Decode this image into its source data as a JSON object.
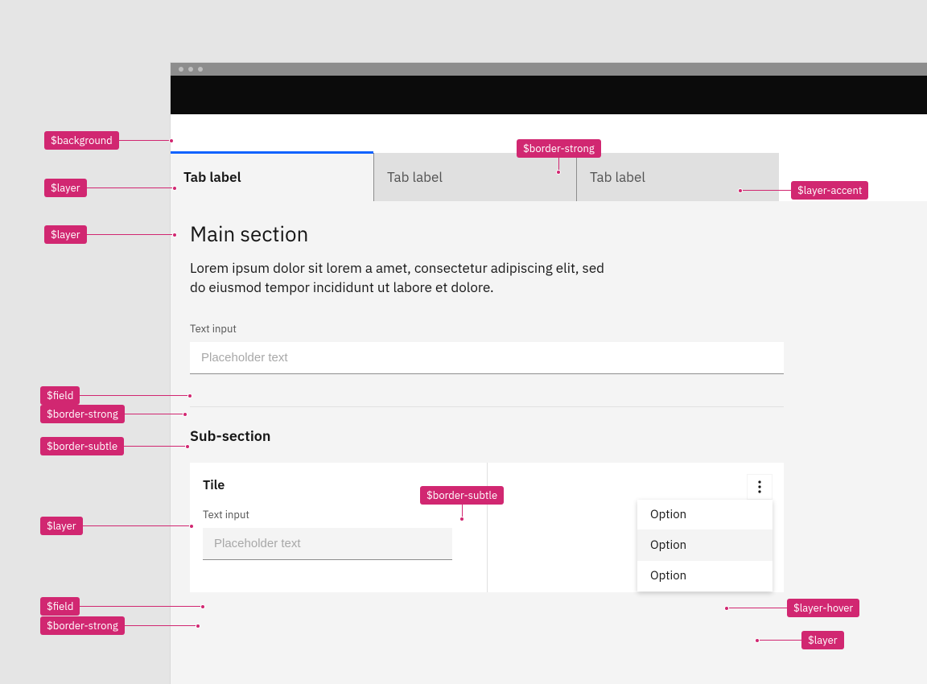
{
  "tokens": {
    "background": "$background",
    "layer": "$layer",
    "layer_accent": "$layer-accent",
    "layer_hover": "$layer-hover",
    "field": "$field",
    "border_strong": "$border-strong",
    "border_subtle": "$border-subtle"
  },
  "tabs": [
    {
      "label": "Tab label",
      "selected": true
    },
    {
      "label": "Tab label",
      "selected": false
    },
    {
      "label": "Tab label",
      "selected": false
    }
  ],
  "main": {
    "heading": "Main section",
    "body": "Lorem ipsum dolor sit lorem a amet, consectetur adipiscing elit, sed do eiusmod tempor incididunt ut labore et dolore.",
    "input": {
      "label": "Text input",
      "placeholder": "Placeholder text"
    }
  },
  "sub": {
    "heading": "Sub-section",
    "tile": {
      "title": "Tile",
      "input": {
        "label": "Text input",
        "placeholder": "Placeholder text"
      }
    },
    "menu": {
      "items": [
        "Option",
        "Option",
        "Option"
      ],
      "hover_index": 1
    }
  }
}
